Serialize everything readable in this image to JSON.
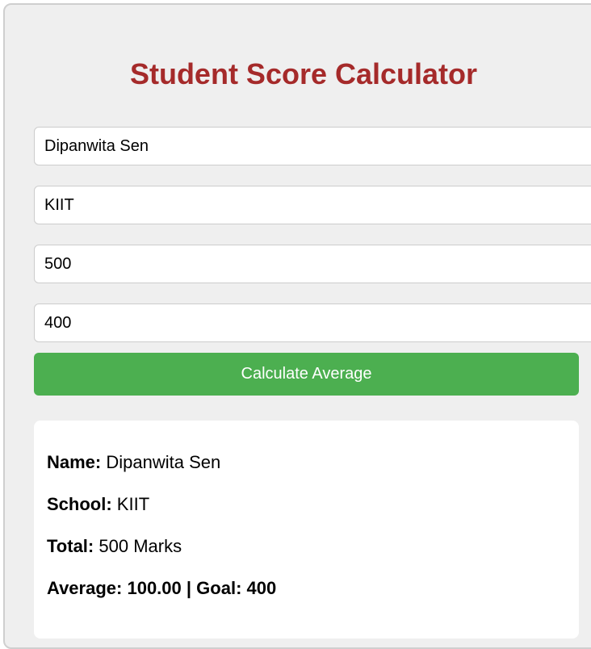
{
  "app": {
    "title": "Student Score Calculator"
  },
  "form": {
    "name_value": "Dipanwita Sen",
    "school_value": "KIIT",
    "total_value": "500",
    "goal_value": "400",
    "button_label": "Calculate Average"
  },
  "result": {
    "name_label": "Name:",
    "name_value": "Dipanwita Sen",
    "school_label": "School:",
    "school_value": "KIIT",
    "total_label": "Total:",
    "total_value": "500 Marks",
    "average_label": "Average:",
    "average_value": "100.00",
    "separator": "|",
    "goal_label": "Goal:",
    "goal_value": "400"
  },
  "colors": {
    "title": "#a52a2a",
    "button": "#4caf50",
    "card_background": "#efefef"
  }
}
